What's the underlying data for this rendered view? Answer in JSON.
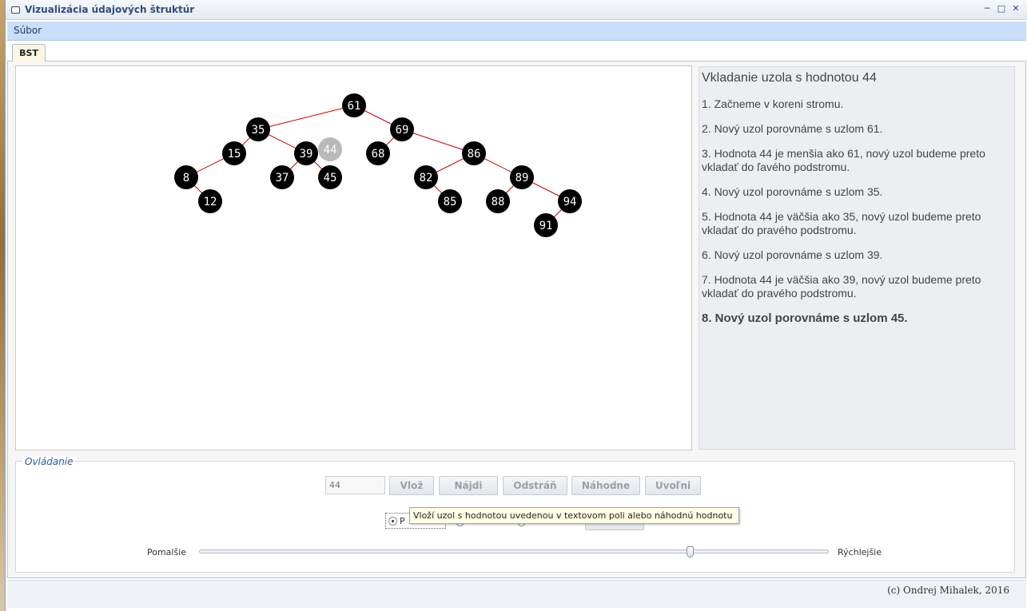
{
  "window": {
    "title": "Vizualizácia údajových štruktúr"
  },
  "menu": {
    "file": "Súbor"
  },
  "tabs": [
    {
      "label": "BST",
      "active": true
    }
  ],
  "tree": {
    "nodes": [
      {
        "id": "61",
        "label": "61",
        "state": "normal"
      },
      {
        "id": "35",
        "label": "35",
        "state": "normal"
      },
      {
        "id": "69",
        "label": "69",
        "state": "normal"
      },
      {
        "id": "15",
        "label": "15",
        "state": "normal"
      },
      {
        "id": "39",
        "label": "39",
        "state": "normal"
      },
      {
        "id": "44",
        "label": "44",
        "state": "inserting"
      },
      {
        "id": "68",
        "label": "68",
        "state": "normal"
      },
      {
        "id": "86",
        "label": "86",
        "state": "normal"
      },
      {
        "id": "8",
        "label": "8",
        "state": "normal"
      },
      {
        "id": "37",
        "label": "37",
        "state": "normal"
      },
      {
        "id": "45",
        "label": "45",
        "state": "normal"
      },
      {
        "id": "82",
        "label": "82",
        "state": "normal"
      },
      {
        "id": "89",
        "label": "89",
        "state": "normal"
      },
      {
        "id": "12",
        "label": "12",
        "state": "normal"
      },
      {
        "id": "85",
        "label": "85",
        "state": "normal"
      },
      {
        "id": "88",
        "label": "88",
        "state": "normal"
      },
      {
        "id": "94",
        "label": "94",
        "state": "normal"
      },
      {
        "id": "91",
        "label": "91",
        "state": "normal"
      }
    ],
    "edges": [
      [
        "61",
        "35"
      ],
      [
        "61",
        "69"
      ],
      [
        "35",
        "15"
      ],
      [
        "35",
        "39"
      ],
      [
        "15",
        "8"
      ],
      [
        "8",
        "12"
      ],
      [
        "39",
        "37"
      ],
      [
        "39",
        "45"
      ],
      [
        "69",
        "68"
      ],
      [
        "69",
        "86"
      ],
      [
        "86",
        "82"
      ],
      [
        "86",
        "89"
      ],
      [
        "82",
        "85"
      ],
      [
        "89",
        "88"
      ],
      [
        "89",
        "94"
      ],
      [
        "94",
        "91"
      ]
    ],
    "colors": {
      "node": "#000000",
      "node_text": "#ffffff",
      "edge": "#cc0000",
      "inserting": "#b9b9b9"
    }
  },
  "log": {
    "title": "Vkladanie uzola s hodnotou 44",
    "steps": [
      {
        "text": "1. Začneme v koreni stromu.",
        "active": false
      },
      {
        "text": "2. Nový uzol porovnáme s uzlom 61.",
        "active": false
      },
      {
        "text": "3. Hodnota 44 je menšia ako 61, nový uzol budeme preto vkladať do ľavého podstromu.",
        "active": false
      },
      {
        "text": "4. Nový uzol porovnáme s uzlom 35.",
        "active": false
      },
      {
        "text": "5. Hodnota 44 je väčšia ako 35, nový uzol budeme preto vkladať do pravého podstromu.",
        "active": false
      },
      {
        "text": "6. Nový uzol porovnáme s uzlom 39.",
        "active": false
      },
      {
        "text": "7. Hodnota 44 je väčšia ako 39, nový uzol budeme preto vkladať do pravého podstromu.",
        "active": false
      },
      {
        "text": "8. Nový uzol porovnáme s uzlom 45.",
        "active": true
      }
    ]
  },
  "controls": {
    "legend": "Ovládanie",
    "input_placeholder": "44",
    "buttons": {
      "insert": "Vlož",
      "find": "Nájdi",
      "delete": "Odstráň",
      "random": "Náhodne",
      "free": "Uvoľni"
    },
    "tooltip": "Vloží uzol s hodnotou uvedenou v textovom poli alebo náhodnú hodnotu",
    "traversal_selected": "P",
    "speed": {
      "slower": "Pomalšie",
      "faster": "Rýchlejšie",
      "level": 0.78
    }
  },
  "footer": {
    "copyright": "(c) Ondrej Mihalek, 2016"
  }
}
